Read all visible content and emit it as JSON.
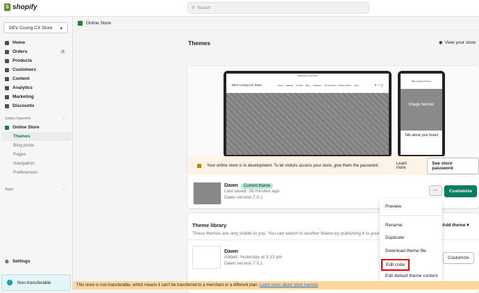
{
  "app": {
    "logo": "shopify",
    "search_placeholder": "Search"
  },
  "sidebar": {
    "store": "DEV Cuong CX Store",
    "items": [
      {
        "label": "Home"
      },
      {
        "label": "Orders",
        "badge": "2"
      },
      {
        "label": "Products"
      },
      {
        "label": "Customers"
      },
      {
        "label": "Content"
      },
      {
        "label": "Analytics"
      },
      {
        "label": "Marketing"
      },
      {
        "label": "Discounts"
      }
    ],
    "sales_channels": "Sales channels",
    "online_store": "Online Store",
    "sub": [
      "Themes",
      "Blog posts",
      "Pages",
      "Navigation",
      "Preferences"
    ],
    "apps": "Apps",
    "settings": "Settings",
    "non_transferable": "Non-transferable"
  },
  "breadcrumb": "Online Store",
  "page": {
    "title": "Themes",
    "view_store": "View your store"
  },
  "preview": {
    "announcement": "Welcome to our store",
    "store_name": "DEV Cuong CX Store",
    "nav": [
      "Home",
      "Catalog",
      "Contact",
      "Blog",
      "Collection",
      "All products",
      "Privacy Policy",
      "Form"
    ],
    "banner": "Image banner",
    "talk": "Talk about your brand"
  },
  "dev_banner": {
    "text": "Your online store is in development. To let visitors access your store, give them the password.",
    "learn_more": "Learn more",
    "button": "See store password"
  },
  "current": {
    "name": "Dawn",
    "badge": "Current theme",
    "saved": "Last saved: 39 minutes ago",
    "version": "Dawn version 7.0.1",
    "customize": "Customize"
  },
  "library": {
    "title": "Theme library",
    "desc": "These themes are only visible to you. You can switch to another theme by publishing it to your store.",
    "add": "Add theme",
    "theme": {
      "name": "Dawn",
      "added": "Added: Yesterday at 3:13 pm",
      "version": "Dawn version 7.0.1",
      "customize": "Customize"
    }
  },
  "menu": [
    "Preview",
    "Rename",
    "Duplicate",
    "Download theme file",
    "Edit code",
    "Edit default theme content"
  ],
  "footer": {
    "text": "This store is non-transferable, which means it can't be transferred to a merchant or a different plan. ",
    "link": "Learn more about store transfer"
  }
}
